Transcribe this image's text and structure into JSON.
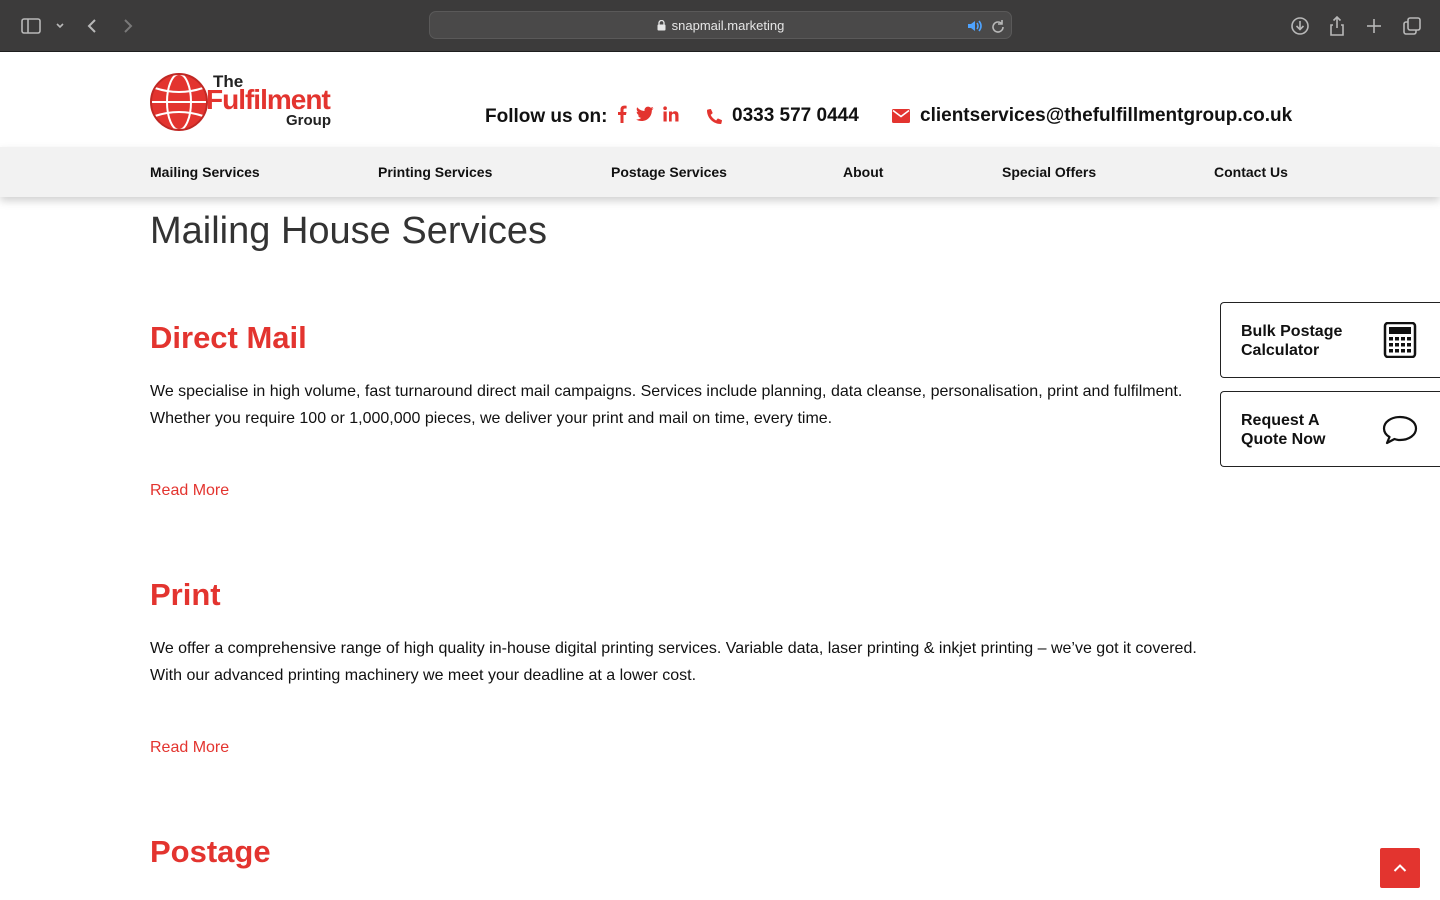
{
  "browser": {
    "url": "snapmail.marketing"
  },
  "header": {
    "logo": {
      "the": "The",
      "main": "Fulfilment",
      "group": "Group"
    },
    "follow_label": "Follow us on:",
    "social": [
      {
        "name": "facebook-icon",
        "glyph": "f"
      },
      {
        "name": "twitter-icon",
        "glyph": "t"
      },
      {
        "name": "linkedin-icon",
        "glyph": "in"
      }
    ],
    "phone": "0333 577 0444",
    "email": "clientservices@thefulfillmentgroup.co.uk"
  },
  "nav": {
    "items": [
      {
        "label": "Mailing Services"
      },
      {
        "label": "Printing Services"
      },
      {
        "label": "Postage Services"
      },
      {
        "label": "About"
      },
      {
        "label": "Special Offers"
      },
      {
        "label": "Contact Us"
      }
    ]
  },
  "main": {
    "title": "Mailing House Services",
    "sections": [
      {
        "title": "Direct Mail",
        "lines": [
          "We specialise in high volume, fast turnaround direct mail campaigns. Services include planning, data cleanse, personalisation, print and fulfilment.",
          "Whether you require 100 or 1,000,000 pieces, we deliver your print and mail on time, every time."
        ],
        "read_more": "Read More"
      },
      {
        "title": "Print",
        "lines": [
          "We offer a comprehensive range of high quality in-house digital printing services. Variable data, laser printing & inkjet printing – we’ve got it covered.",
          "With our advanced printing machinery we meet your deadline at a lower cost."
        ],
        "read_more": "Read More"
      },
      {
        "title": "Postage",
        "lines": [],
        "read_more": ""
      }
    ]
  },
  "side_widgets": {
    "bulk_postage": "Bulk Postage Calculator",
    "request_quote": "Request A Quote Now"
  },
  "colors": {
    "accent": "#e3342f",
    "chrome": "#3c3b3b",
    "nav_bg": "#f2f2f2"
  }
}
